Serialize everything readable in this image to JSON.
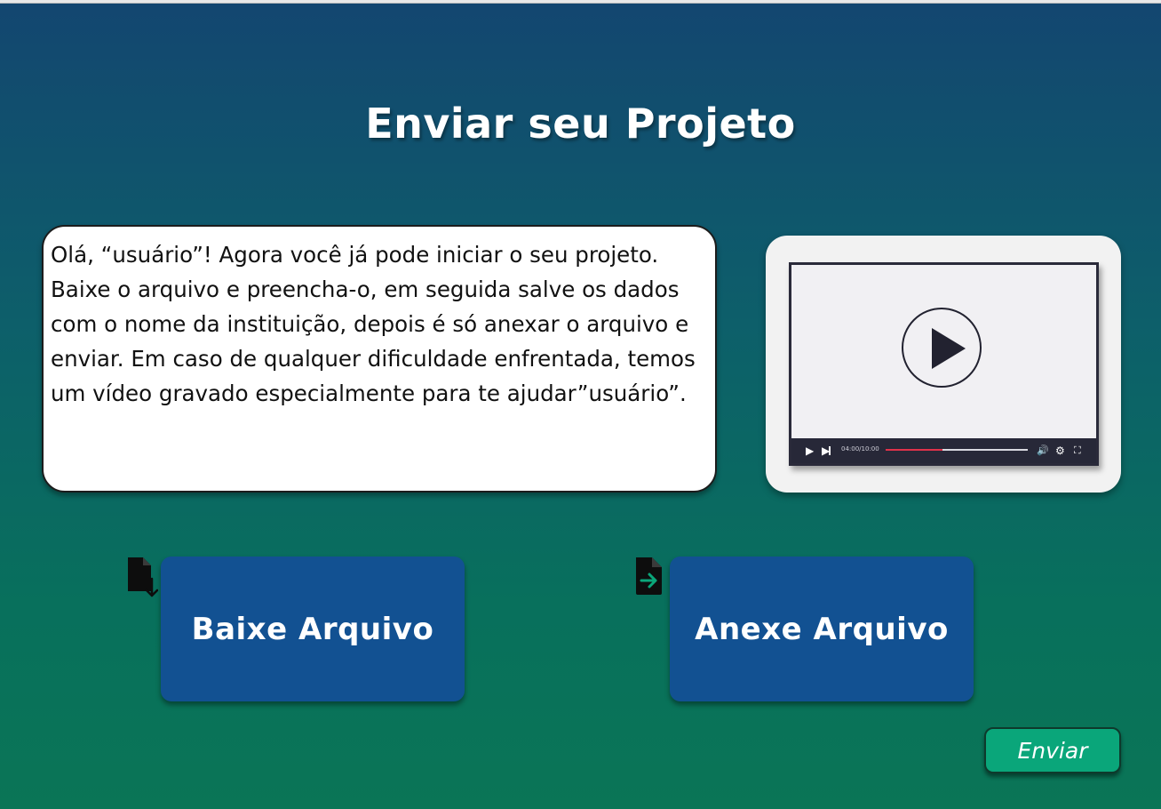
{
  "page": {
    "title": "Enviar seu Projeto"
  },
  "message": {
    "text": "Olá, “usuário”! Agora você já pode iniciar o seu projeto. Baixe o arquivo e preencha-o, em seguida salve os dados com o nome da instituição, depois é só anexar o arquivo e enviar. Em caso de qualquer dificuldade enfrentada, temos um vídeo gravado especialmente para te ajudar”usuário”."
  },
  "video": {
    "time": "04:00/10:00",
    "progress": 0.4,
    "play_icon": "play-icon",
    "next_icon": "skip-next-icon",
    "volume_icon": "volume-icon",
    "settings_icon": "gear-icon",
    "fullscreen_icon": "fullscreen-icon"
  },
  "actions": {
    "download_label": "Baixe Arquivo",
    "download_icon": "file-download-icon",
    "attach_label": "Anexe Arquivo",
    "attach_icon": "file-attach-icon"
  },
  "footer": {
    "send_label": "Enviar"
  },
  "colors": {
    "background_top": "#134670",
    "background_bottom": "#0a7556",
    "action_button": "#125192",
    "send_button": "#0aa67a",
    "progress": "#e0324a"
  }
}
